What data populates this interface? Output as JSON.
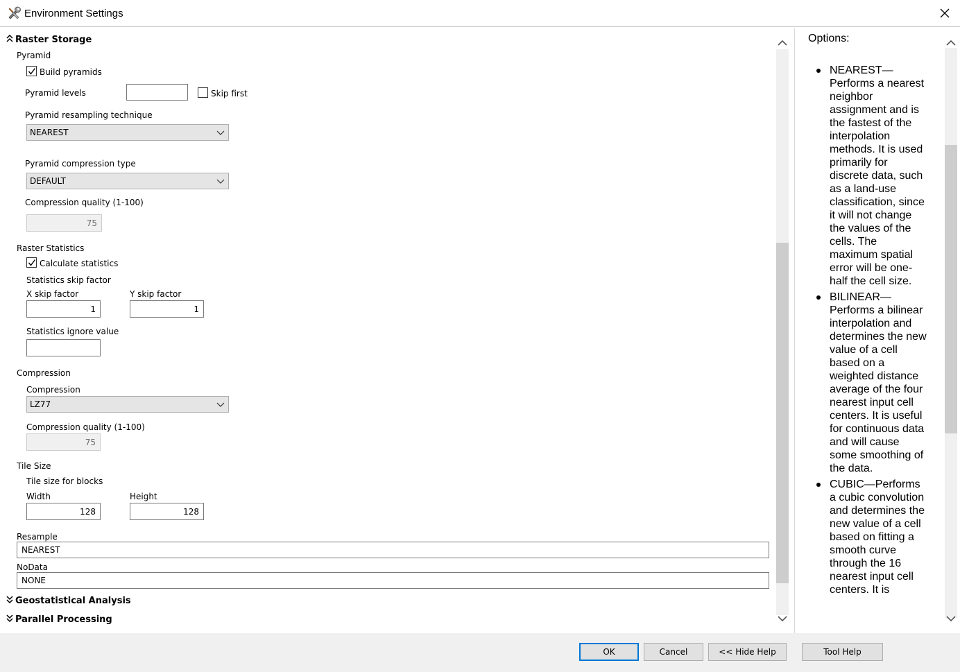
{
  "window": {
    "title": "Environment Settings",
    "close_glyph": "✕",
    "icon": "tools-icon"
  },
  "sections": {
    "raster_storage": "Raster Storage",
    "geostatistical_analysis": "Geostatistical Analysis",
    "parallel_processing": "Parallel Processing"
  },
  "pyramid": {
    "group_label": "Pyramid",
    "build_pyramids_label": "Build pyramids",
    "build_pyramids_checked": true,
    "levels_label": "Pyramid levels",
    "levels_value": "",
    "skip_first_label": "Skip first",
    "skip_first_checked": false,
    "resampling_label": "Pyramid resampling technique",
    "resampling_value": "NEAREST",
    "compression_type_label": "Pyramid compression type",
    "compression_type_value": "DEFAULT",
    "compression_quality_label": "Compression quality (1-100)",
    "compression_quality_value": "75"
  },
  "raster_statistics": {
    "group_label": "Raster Statistics",
    "calculate_label": "Calculate statistics",
    "calculate_checked": true,
    "skip_factor_label": "Statistics skip factor",
    "x_skip_label": "X skip factor",
    "x_skip_value": "1",
    "y_skip_label": "Y skip factor",
    "y_skip_value": "1",
    "ignore_value_label": "Statistics ignore value",
    "ignore_value": ""
  },
  "compression": {
    "group_label": "Compression",
    "type_label": "Compression",
    "type_value": "LZ77",
    "quality_label": "Compression quality (1-100)",
    "quality_value": "75"
  },
  "tile_size": {
    "group_label": "Tile Size",
    "sub_label": "Tile size for blocks",
    "width_label": "Width",
    "width_value": "128",
    "height_label": "Height",
    "height_value": "128"
  },
  "resample": {
    "label": "Resample",
    "value": "NEAREST"
  },
  "nodata": {
    "label": "NoData",
    "value": "NONE"
  },
  "help": {
    "title": "Options:",
    "items": [
      "NEAREST—Performs a nearest neighbor assignment and is the fastest of the interpolation methods. It is used primarily for discrete data, such as a land-use classification, since it will not change the values of the cells. The maximum spatial error will be one-half the cell size.",
      "BILINEAR—Performs a bilinear interpolation and determines the new value of a cell based on a weighted distance average of the four nearest input cell centers. It is useful for continuous data and will cause some smoothing of the data.",
      "CUBIC—Performs a cubic convolution and determines the new value of a cell based on fitting a smooth curve through the 16 nearest input cell centers. It is"
    ]
  },
  "buttons": {
    "ok": "OK",
    "cancel": "Cancel",
    "hide_help": "<< Hide Help",
    "tool_help": "Tool Help"
  },
  "colors": {
    "default_button_border": "#0078d7",
    "footer_bg": "#f0f0f0",
    "combo_bg": "#e5e5e5",
    "scroll_thumb": "#cdcdcd"
  }
}
